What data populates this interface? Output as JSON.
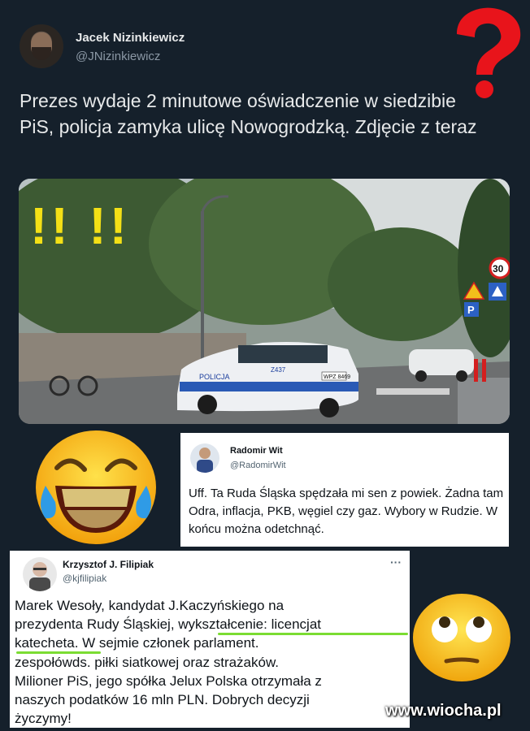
{
  "main_tweet": {
    "name": "Jacek Nizinkiewicz",
    "handle": "@JNizinkiewicz",
    "text": "Prezes wydaje 2 minutowe oświadczenie w siedzibie PiS, policja zamyka ulicę Nowogrodzką. Zdjęcie z teraz"
  },
  "photo": {
    "overlay_text": "!! !!",
    "police_word": "POLICJA",
    "plate": "WPZ 8469",
    "car_number": "Z437",
    "speed_sign": "30",
    "parking_sign": "P"
  },
  "quote1": {
    "name": "Radomir Wit",
    "handle": "@RadomirWit",
    "text": "Uff. Ta Ruda Śląska spędzała mi sen z powiek. Żadna tam Odra, inflacja, PKB, węgiel czy gaz. Wybory w Rudzie. W końcu można odetchnąć."
  },
  "quote2": {
    "name": "Krzysztof J. Filipiak",
    "handle": "@kjfilipiak",
    "menu": "···",
    "lines": [
      "Marek Wesoły, kandydat J.Kaczyńskiego na",
      "prezydenta Rudy Śląskiej, wykształcenie: licencjat",
      "katecheta. W sejmie członek parlament.",
      "zespołówds. piłki siatkowej oraz strażaków.",
      "Milioner PiS, jego spółka Jelux Polska otrzymała z",
      "naszych podatków 16 mln PLN. Dobrych decyzji",
      "życzymy!"
    ]
  },
  "watermark": "www.wiocha.pl",
  "colors": {
    "background": "#15202b",
    "highlight": "#7bdc32",
    "question_mark": "#e8141b",
    "exclamation": "#f4e016"
  },
  "icons": [
    "question-mark-icon",
    "laughing-crying-emoji",
    "rolling-eyes-emoji"
  ]
}
